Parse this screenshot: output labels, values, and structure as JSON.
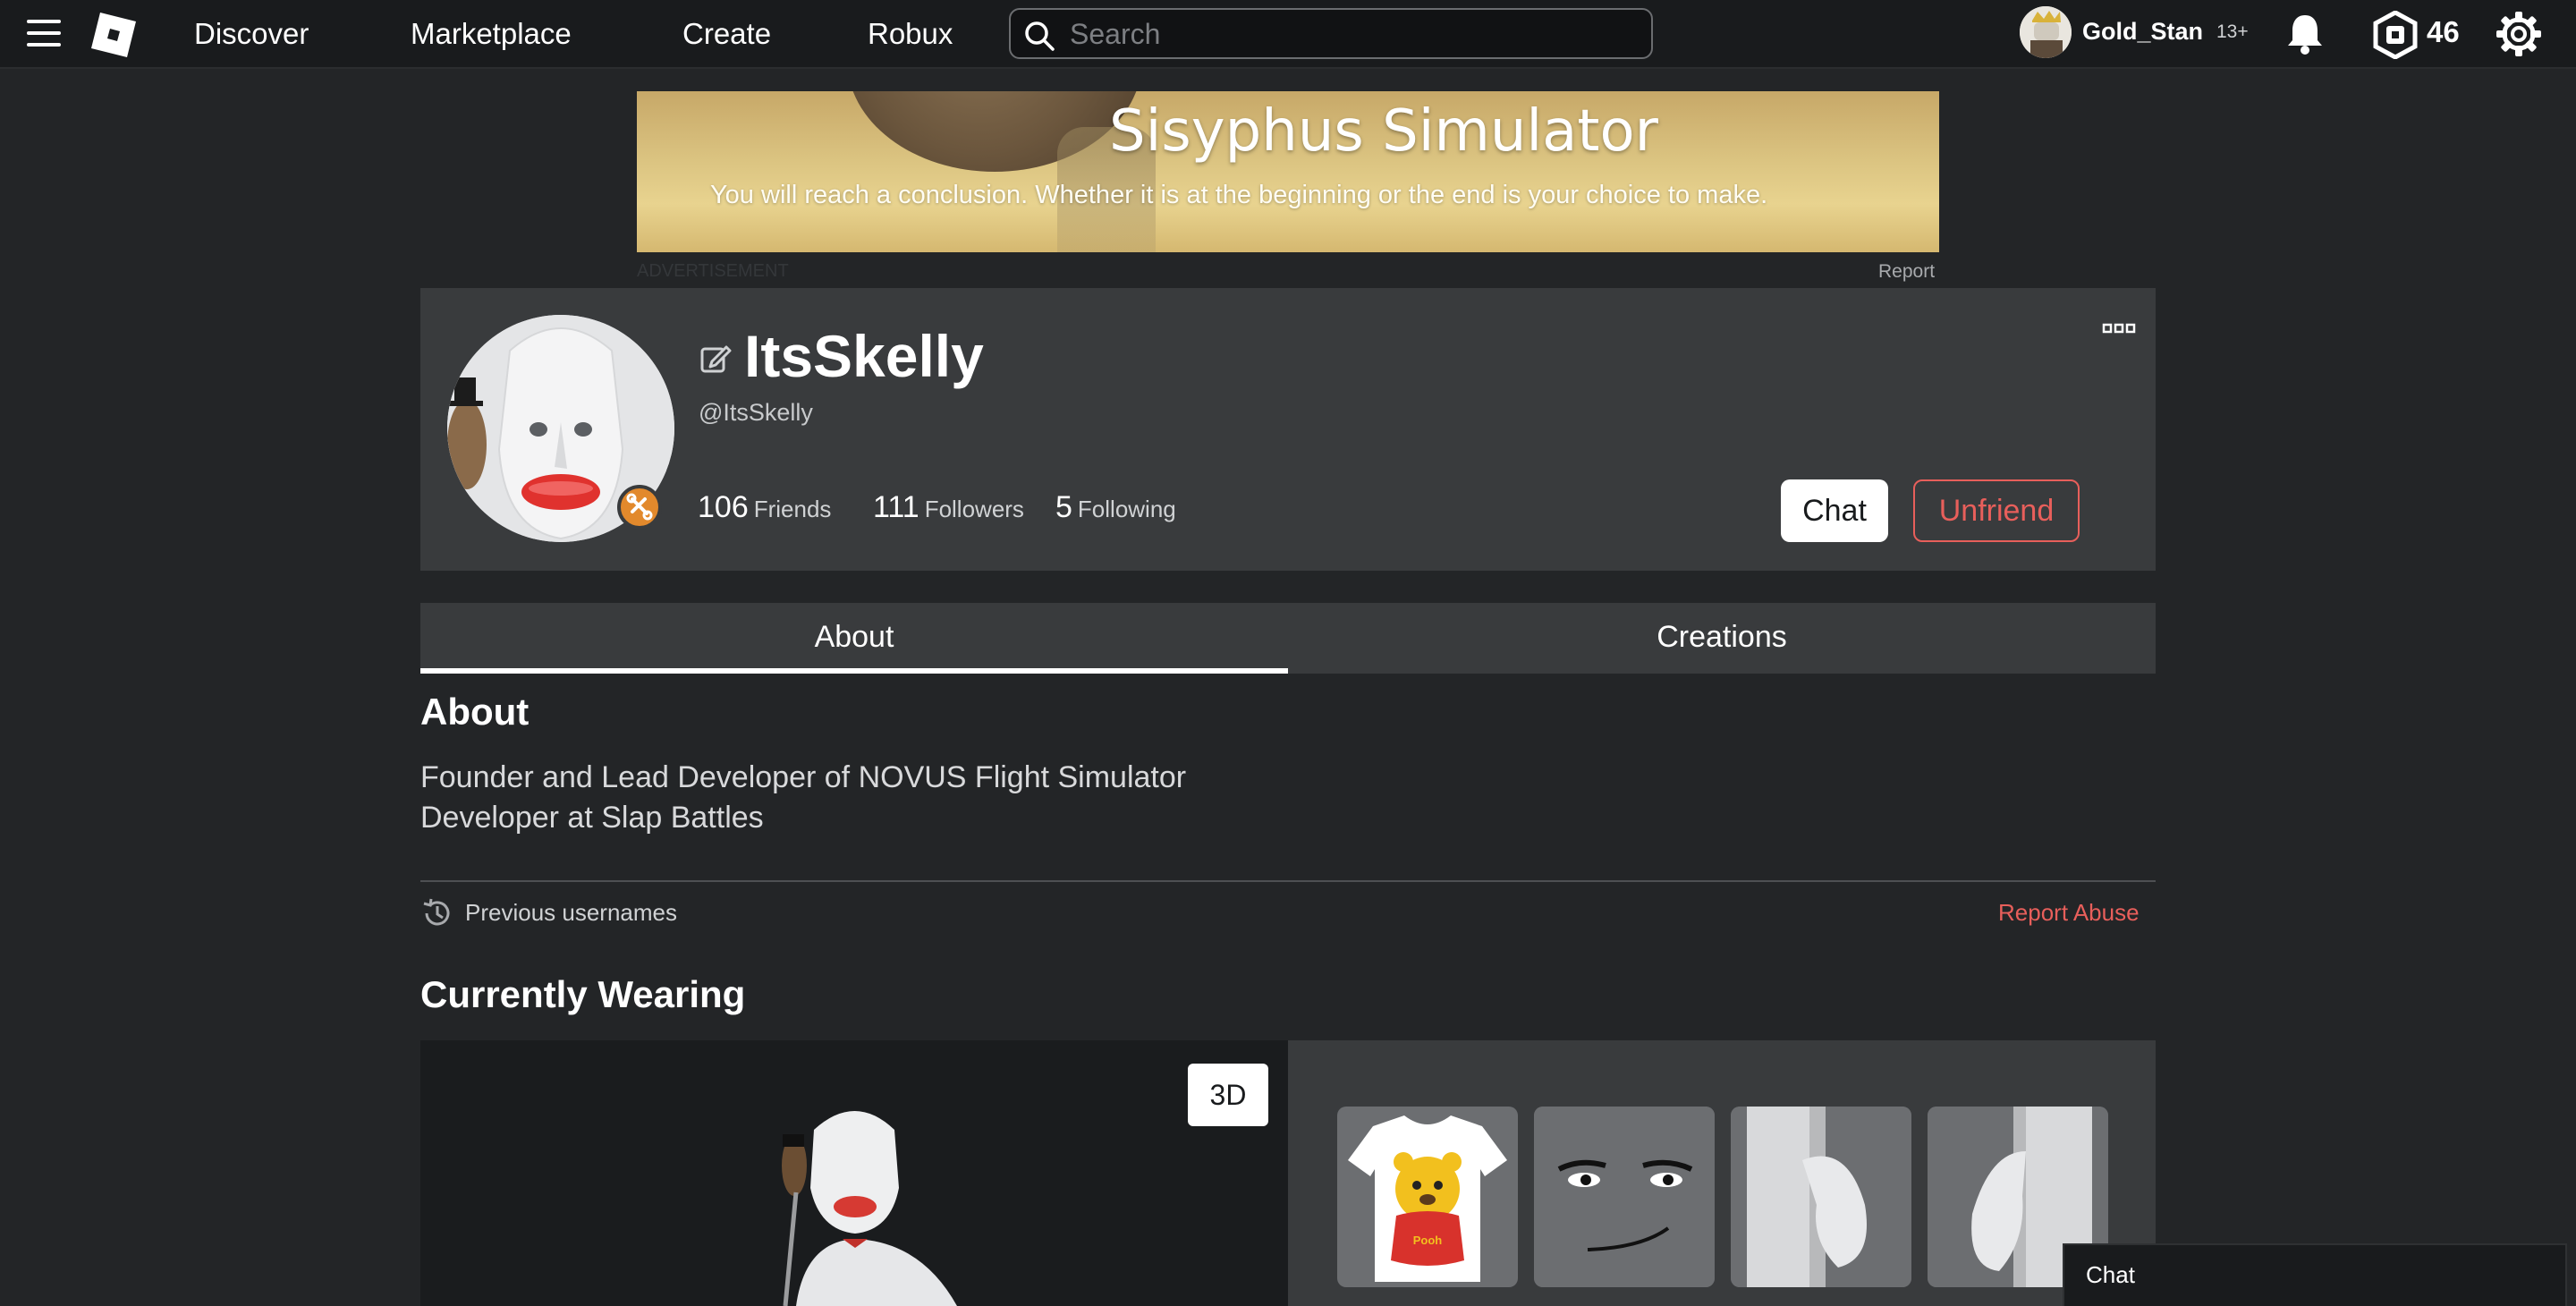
{
  "nav": {
    "links": [
      "Discover",
      "Marketplace",
      "Create",
      "Robux"
    ],
    "search_placeholder": "Search",
    "username": "Gold_Stan",
    "age_label": "13+",
    "robux_balance": "46"
  },
  "ad": {
    "title": "Sisyphus Simulator",
    "subtitle": "You will reach a conclusion. Whether it is at the beginning or the end is your choice to make.",
    "label": "ADVERTISEMENT",
    "report": "Report"
  },
  "profile": {
    "display_name": "ItsSkelly",
    "handle": "@ItsSkelly",
    "stats": [
      {
        "value": "106",
        "label": "Friends"
      },
      {
        "value": "111",
        "label": "Followers"
      },
      {
        "value": "5",
        "label": "Following"
      }
    ],
    "chat_button": "Chat",
    "unfriend_button": "Unfriend"
  },
  "tabs": [
    {
      "label": "About",
      "active": true
    },
    {
      "label": "Creations",
      "active": false
    }
  ],
  "about": {
    "heading": "About",
    "lines": [
      "Founder and Lead Developer of NOVUS Flight Simulator",
      "Developer at Slap Battles"
    ],
    "previous_usernames": "Previous usernames",
    "report_abuse": "Report Abuse"
  },
  "wearing": {
    "heading": "Currently Wearing",
    "view_toggle": "3D",
    "items": [
      {
        "name": "pooh-shirt",
        "shirt_text": "Pooh"
      },
      {
        "name": "face"
      },
      {
        "name": "right-arm"
      },
      {
        "name": "left-arm"
      }
    ]
  },
  "chat_dock": {
    "label": "Chat"
  },
  "colors": {
    "background": "#232527",
    "nav": "#191b1d",
    "card": "#393b3d",
    "danger": "#e85f5b",
    "badge": "#e2892c"
  }
}
